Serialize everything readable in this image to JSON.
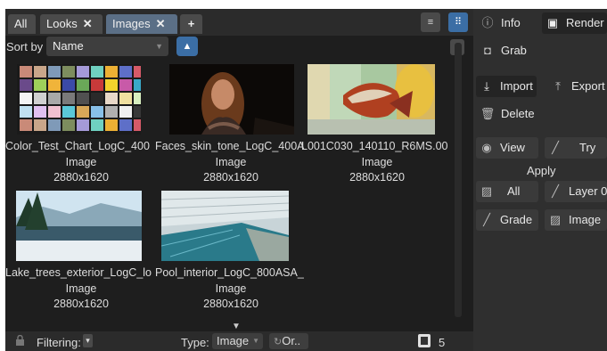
{
  "tabs": [
    {
      "label": "All",
      "closable": false,
      "active": false
    },
    {
      "label": "Looks",
      "closable": true,
      "active": false
    },
    {
      "label": "Images",
      "closable": true,
      "active": true
    }
  ],
  "tab_add_label": "+",
  "tab_close_glyph": "✕",
  "header_buttons": {
    "list_icon": "≡",
    "grid_icon": "⠿",
    "menu_icon": "▾"
  },
  "sort": {
    "label": "Sort by",
    "value": "Name",
    "direction_icon": "▲"
  },
  "items": [
    {
      "name": "Color_Test_Chart_LogC_400",
      "type": "Image",
      "resolution": "2880x1620",
      "thumb": "color-chart"
    },
    {
      "name": "Faces_skin_tone_LogC_400A",
      "type": "Image",
      "resolution": "2880x1620",
      "thumb": "face"
    },
    {
      "name": "L001C030_140110_R6MS.00",
      "type": "Image",
      "resolution": "2880x1620",
      "thumb": "fish"
    },
    {
      "name": "Lake_trees_exterior_LogC_lo",
      "type": "Image",
      "resolution": "2880x1620",
      "thumb": "lake"
    },
    {
      "name": "Pool_interior_LogC_800ASA_",
      "type": "Image",
      "resolution": "2880x1620",
      "thumb": "pool"
    }
  ],
  "scroll_down_icon": "▼",
  "footer": {
    "lock_icon": "lock-icon",
    "filtering_label": "Filtering:",
    "filter_icon": "▾",
    "type_label": "Type:",
    "type_value": "Image",
    "or_label": "Or..",
    "items_count": "5 items"
  },
  "right_panel": {
    "info_label": "Info",
    "render_label": "Render",
    "grab_label": "Grab",
    "import_label": "Import",
    "export_label": "Export",
    "delete_label": "Delete",
    "view_label": "View",
    "try_label": "Try",
    "apply_label": "Apply",
    "all_label": "All",
    "layer_label": "Layer 0",
    "grade_label": "Grade",
    "image_label": "Image"
  },
  "colors": {
    "accent": "#3b6ea5",
    "active_tab": "#5b6f86",
    "panel_bg": "#1e1e1e",
    "right_bg": "#2f2f2f"
  },
  "chart_swatches": [
    "#c98a78",
    "#c9a68a",
    "#7f9ab8",
    "#7d8d5e",
    "#a59ad8",
    "#6fd0c0",
    "#ecb034",
    "#5e6fc8",
    "#d65a68",
    "#6a4a8a",
    "#9fd05a",
    "#f0b43a",
    "#3b4aa8",
    "#6aa858",
    "#c83a3a",
    "#f2d22c",
    "#c85aa8",
    "#3aa8c8",
    "#f4f4f4",
    "#d0d0d0",
    "#a8a8a8",
    "#7a7a7a",
    "#505050",
    "#2a2a2a",
    "#e8d8c8",
    "#f0e0a0",
    "#d8f0c0",
    "#c0e0f0",
    "#e0c0f0",
    "#f0c0d0",
    "#5ac8d8",
    "#d8a858",
    "#88c0e8",
    "#b0b0b0",
    "#f0f0f0",
    "#383838"
  ]
}
